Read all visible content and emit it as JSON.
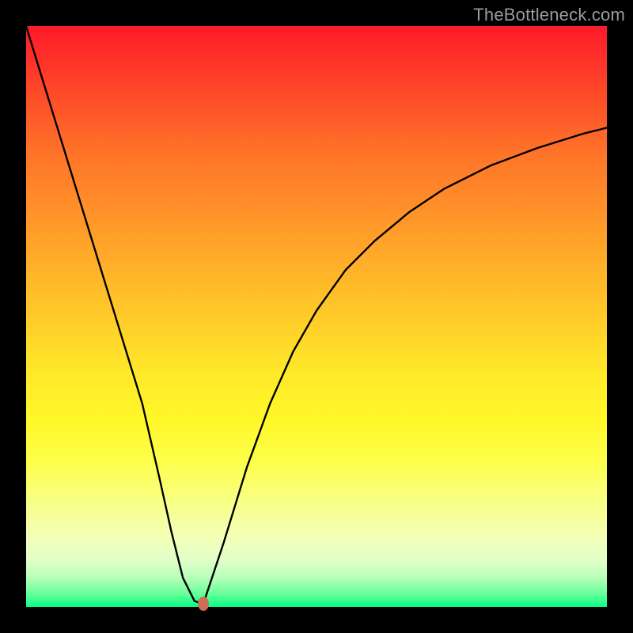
{
  "watermark": "TheBottleneck.com",
  "chart_data": {
    "type": "line",
    "title": "",
    "xlabel": "",
    "ylabel": "",
    "xlim": [
      0,
      100
    ],
    "ylim": [
      0,
      100
    ],
    "grid": false,
    "legend": false,
    "series": [
      {
        "name": "curve",
        "x": [
          0,
          4,
          8,
          12,
          16,
          20,
          23,
          25,
          27,
          29,
          30.5,
          34,
          38,
          42,
          46,
          50,
          55,
          60,
          66,
          72,
          80,
          88,
          96,
          100
        ],
        "y": [
          100,
          87,
          74,
          61,
          48,
          35,
          22,
          13,
          5,
          1,
          0.5,
          11,
          24,
          35,
          44,
          51,
          58,
          63,
          68,
          72,
          76,
          79,
          81.5,
          82.5
        ]
      }
    ],
    "marker": {
      "x": 30.5,
      "y": 0.5,
      "color": "#cf6d56"
    },
    "background_gradient": {
      "top": "#fe1a29",
      "mid": "#fff829",
      "bottom": "#05ff85"
    }
  }
}
